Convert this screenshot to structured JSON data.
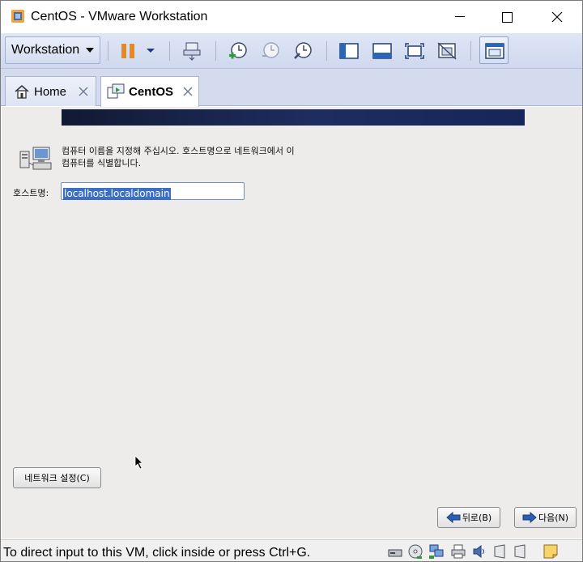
{
  "window": {
    "title": "CentOS - VMware Workstation"
  },
  "toolbar": {
    "workstation_label": "Workstation"
  },
  "tabs": [
    {
      "label": "Home"
    },
    {
      "label": "CentOS"
    }
  ],
  "installer": {
    "instructions": "컴퓨터 이름을 지정해 주십시오. 호스트명으로 네트워크에서 이 컴퓨터를 식별합니다.",
    "hostname_label": "호스트명:",
    "hostname_value": "localhost.localdomain",
    "network_button": "네트워크 설정(C)",
    "back_button": "뒤로(B)",
    "next_button": "다음(N)"
  },
  "statusbar": {
    "message": "To direct input to this VM, click inside or press Ctrl+G."
  },
  "colors": {
    "banner": "#1e2d60",
    "selection": "#3b6fc7",
    "toolbar_bg": "#d6def2",
    "pause_orange": "#e08a2c"
  }
}
